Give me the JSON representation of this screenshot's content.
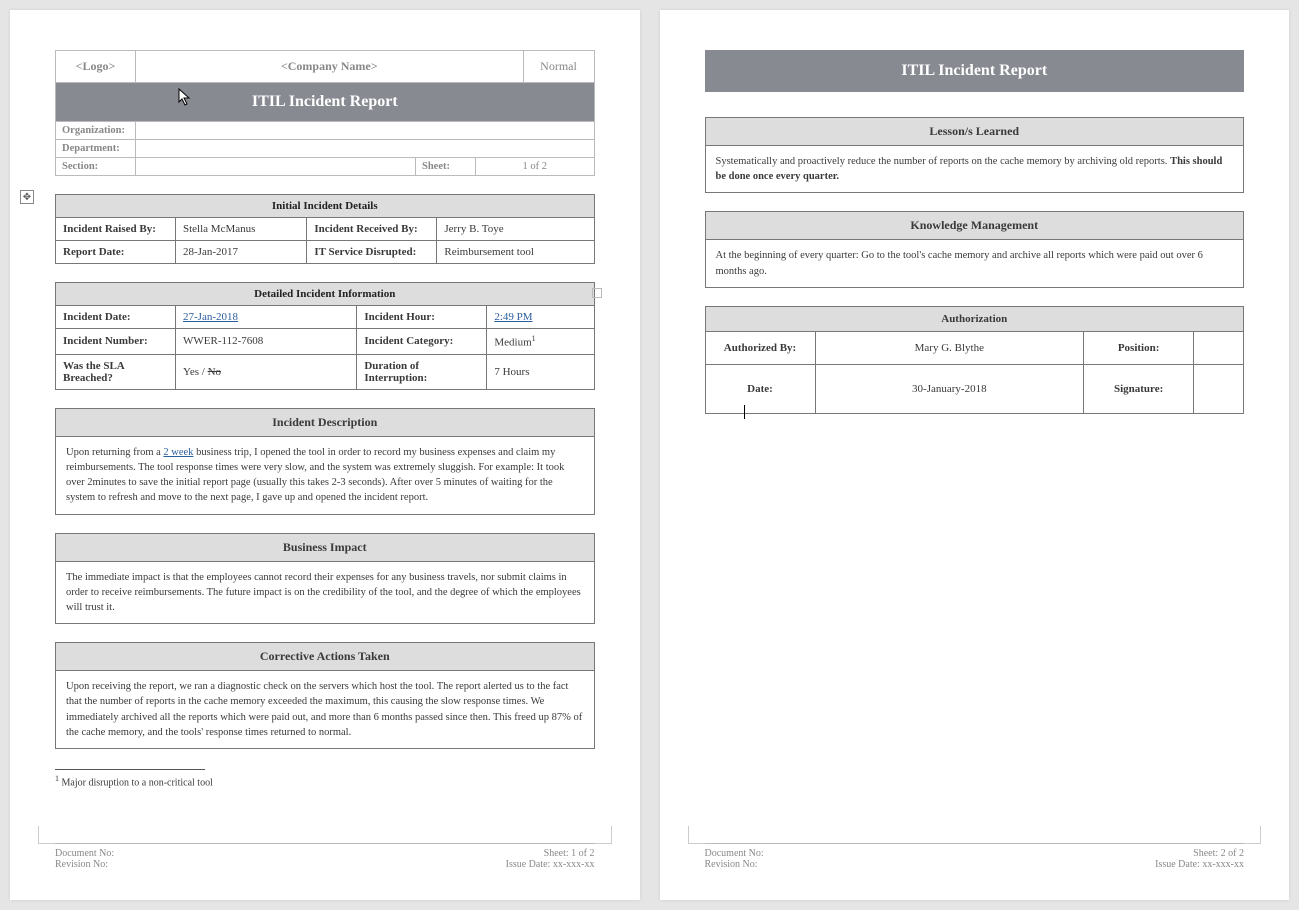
{
  "header": {
    "logo": "<Logo>",
    "company": "<Company Name>",
    "normal": "Normal",
    "title": "ITIL Incident Report",
    "org_label": "Organization:",
    "dept_label": "Department:",
    "section_label": "Section:",
    "sheet_label": "Sheet:",
    "sheet_value": "1 of 2"
  },
  "initial": {
    "title": "Initial Incident Details",
    "raised_by_label": "Incident Raised By:",
    "raised_by": "Stella McManus",
    "received_by_label": "Incident Received By:",
    "received_by": "Jerry B. Toye",
    "report_date_label": "Report Date:",
    "report_date": "28-Jan-2017",
    "service_label": "IT Service Disrupted:",
    "service": "Reimbursement tool"
  },
  "detailed": {
    "title": "Detailed Incident Information",
    "date_label": "Incident Date:",
    "date": "27-Jan-2018",
    "hour_label": "Incident Hour:",
    "hour": "2:49 PM",
    "number_label": "Incident Number:",
    "number": "WWER-112-7608",
    "category_label": "Incident Category:",
    "category": "Medium",
    "category_sup": "1",
    "sla_label": "Was the SLA Breached?",
    "sla_yes": "Yes / ",
    "sla_no": "No",
    "duration_label": "Duration of Interruption:",
    "duration": "7 Hours"
  },
  "description": {
    "title": "Incident Description",
    "text_pre": "Upon returning from a ",
    "link": "2 week",
    "text_post": " business trip, I opened the tool in order to record my business expenses and claim my reimbursements. The tool response times were very slow, and the system was extremely sluggish. For example: It took over 2minutes to save the initial report page (usually this takes 2-3 seconds). After over 5 minutes of waiting for the system to refresh and move to the next page, I gave up and opened the incident report."
  },
  "impact": {
    "title": "Business Impact",
    "text": "The immediate impact is that the employees cannot record their expenses for any business travels, nor submit claims in order to receive reimbursements. The future impact is on the credibility of the tool, and the degree of which the employees will trust it."
  },
  "corrective": {
    "title": "Corrective Actions Taken",
    "text": "Upon receiving the report, we ran a diagnostic check on the servers which host the tool. The report alerted us to the fact that the number of reports in the cache memory exceeded the maximum, this causing the slow response times. We immediately archived all the reports which were paid out, and more than 6 months passed since then. This freed up 87% of the cache memory, and the tools' response times returned to normal."
  },
  "footnote": {
    "marker": "1",
    "text": " Major disruption to a non-critical tool"
  },
  "footer1": {
    "doc_label": "Document No:",
    "sheet": "Sheet: 1 of 2",
    "rev_label": "Revision No:",
    "issue": "Issue Date: xx-xxx-xx"
  },
  "page2": {
    "title": "ITIL Incident Report",
    "lessons_title": "Lesson/s Learned",
    "lessons_text": "Systematically and proactively reduce the number of reports on the cache memory by archiving old reports. ",
    "lessons_bold": "This should be done once every quarter.",
    "km_title": "Knowledge Management",
    "km_text": "At the beginning of every quarter: Go to the tool's cache memory and archive all reports which were paid out over 6 months ago.",
    "auth_title": "Authorization",
    "auth_by_label": "Authorized By:",
    "auth_by": "Mary G. Blythe",
    "position_label": "Position:",
    "date_label": "Date:",
    "date": "30-January-2018",
    "sig_label": "Signature:"
  },
  "footer2": {
    "doc_label": "Document No:",
    "sheet": "Sheet: 2 of 2",
    "rev_label": "Revision No:",
    "issue": "Issue Date: xx-xxx-xx"
  }
}
